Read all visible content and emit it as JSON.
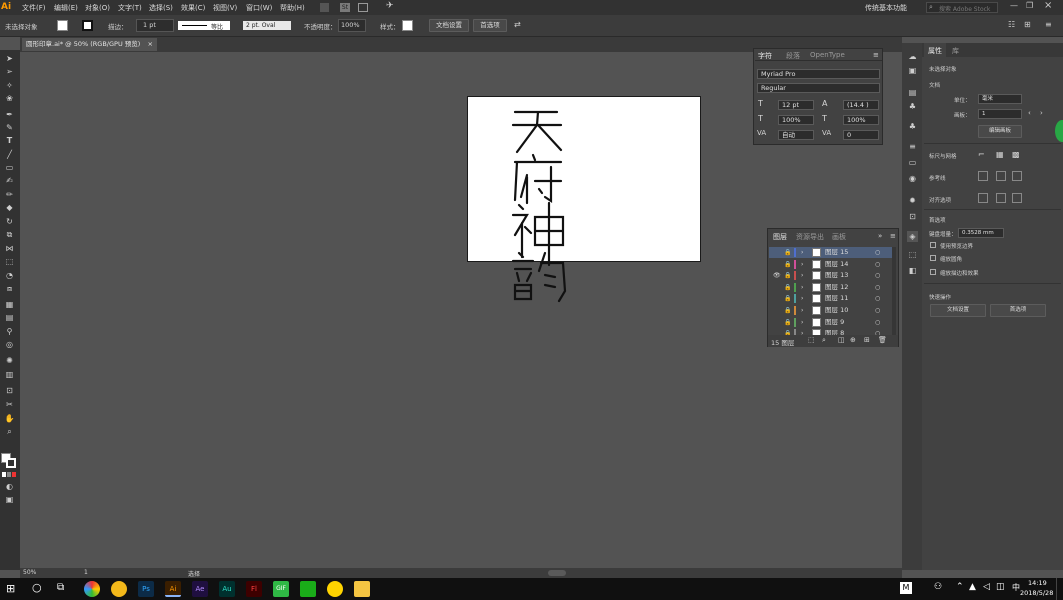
{
  "menu": {
    "logo": "Ai",
    "items": [
      "文件(F)",
      "编辑(E)",
      "对象(O)",
      "文字(T)",
      "选择(S)",
      "效果(C)",
      "视图(V)",
      "窗口(W)",
      "帮助(H)"
    ],
    "st": "St",
    "workspace": "传统基本功能",
    "search_placeholder": "搜索 Adobe Stock"
  },
  "control": {
    "no_selection": "未选择对象",
    "stroke_label": "描边：",
    "stroke_value": "1 pt",
    "uniform": "等比",
    "brush": "2 pt. Oval",
    "opacity_label": "不透明度：",
    "opacity_value": "100%",
    "style_label": "样式：",
    "doc_setup": "文档设置",
    "prefs": "首选项"
  },
  "document": {
    "tab_title": "圆形印章.ai* @ 50% (RGB/GPU 预览)",
    "close": "×"
  },
  "char_panel": {
    "tabs": [
      "字符",
      "段落",
      "OpenType"
    ],
    "font": "Myriad Pro",
    "style": "Regular",
    "size": "12 pt",
    "leading": "(14.4 )",
    "hscale": "100%",
    "vscale": "100%",
    "kerning": "自动",
    "tracking": "0"
  },
  "layers_panel": {
    "tabs": [
      "图层",
      "资源导出",
      "画板"
    ],
    "rows": [
      {
        "name": "图层 15",
        "color": "#4f6fd0",
        "selected": true,
        "visible": false
      },
      {
        "name": "图层 14",
        "color": "#d04f9a",
        "selected": false,
        "visible": false
      },
      {
        "name": "图层 13",
        "color": "#c94f4f",
        "selected": false,
        "visible": true
      },
      {
        "name": "图层 12",
        "color": "#4fa04f",
        "selected": false,
        "visible": false
      },
      {
        "name": "图层 11",
        "color": "#4fa0a0",
        "selected": false,
        "visible": false
      },
      {
        "name": "图层 10",
        "color": "#d08a3c",
        "selected": false,
        "visible": false
      },
      {
        "name": "图层 9",
        "color": "#5fa05f",
        "selected": false,
        "visible": false
      },
      {
        "name": "图层 8",
        "color": "#888",
        "selected": false,
        "visible": false
      }
    ],
    "count": "15 图层"
  },
  "props": {
    "tabs": [
      "属性",
      "库"
    ],
    "no_selection": "未选择对象",
    "doc": "文档",
    "unit_label": "单位：",
    "unit": "毫米",
    "artboard_label": "画板：",
    "artboard": "1",
    "edit_artboard": "编辑画板",
    "rulers": "标尺与网格",
    "guides": "参考线",
    "snap": "对齐选项",
    "prefs_section": "首选项",
    "keyboard_label": "键盘增量：",
    "keyboard_value": "0.3528 mm",
    "check1": "使用预览边界",
    "check2": "缩放圆角",
    "check3": "缩放描边和效果",
    "quick": "快速操作",
    "doc_setup": "文档设置",
    "prefs_btn": "首选项"
  },
  "status": {
    "zoom": "50%",
    "artboard": "1",
    "mode": "选择"
  },
  "taskbar": {
    "time": "14:19",
    "date": "2018/5/28"
  },
  "colors": {
    "accent": "#4a78c4",
    "app_orange": "#ff9a00"
  }
}
